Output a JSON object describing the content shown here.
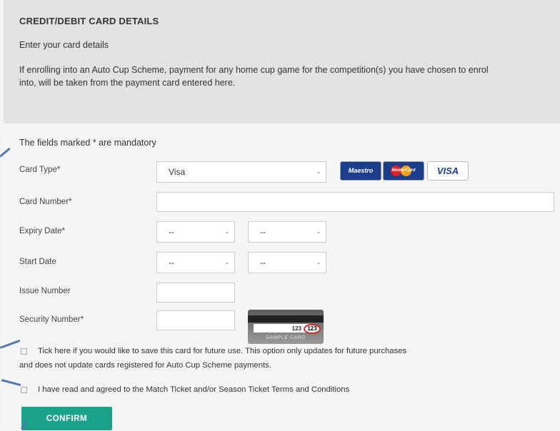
{
  "header": {
    "title": "CREDIT/DEBIT CARD DETAILS",
    "subtitle": "Enter your card details",
    "info": "If enrolling into an Auto Cup Scheme, payment for any home cup game for the competition(s) you have chosen to enrol into, will be taken from the payment card entered here."
  },
  "form": {
    "mandatory_note": "The fields marked * are mandatory",
    "card_type": {
      "label": "Card Type*",
      "value": "Visa"
    },
    "card_number": {
      "label": "Card Number*",
      "value": ""
    },
    "expiry_date": {
      "label": "Expiry Date*",
      "month": "--",
      "year": "--"
    },
    "start_date": {
      "label": "Start Date",
      "month": "--",
      "year": "--"
    },
    "issue_number": {
      "label": "Issue Number",
      "value": ""
    },
    "security_number": {
      "label": "Security Number*",
      "value": ""
    },
    "sample_card": {
      "number": "123",
      "cvv": "123",
      "label": "SAMPLE CARD"
    },
    "card_logos": [
      "Maestro",
      "MasterCard",
      "VISA"
    ],
    "save_card": {
      "line1": "Tick here if you would like to save this card for future use. This option only updates for future purchases",
      "line2": "and does not update cards registered for Auto Cup Scheme payments."
    },
    "terms": "I have read and agreed to the Match Ticket and/or Season Ticket Terms and Conditions",
    "confirm_label": "CONFIRM"
  },
  "colors": {
    "accent": "#1aa38a",
    "pointer": "#5277b4"
  }
}
